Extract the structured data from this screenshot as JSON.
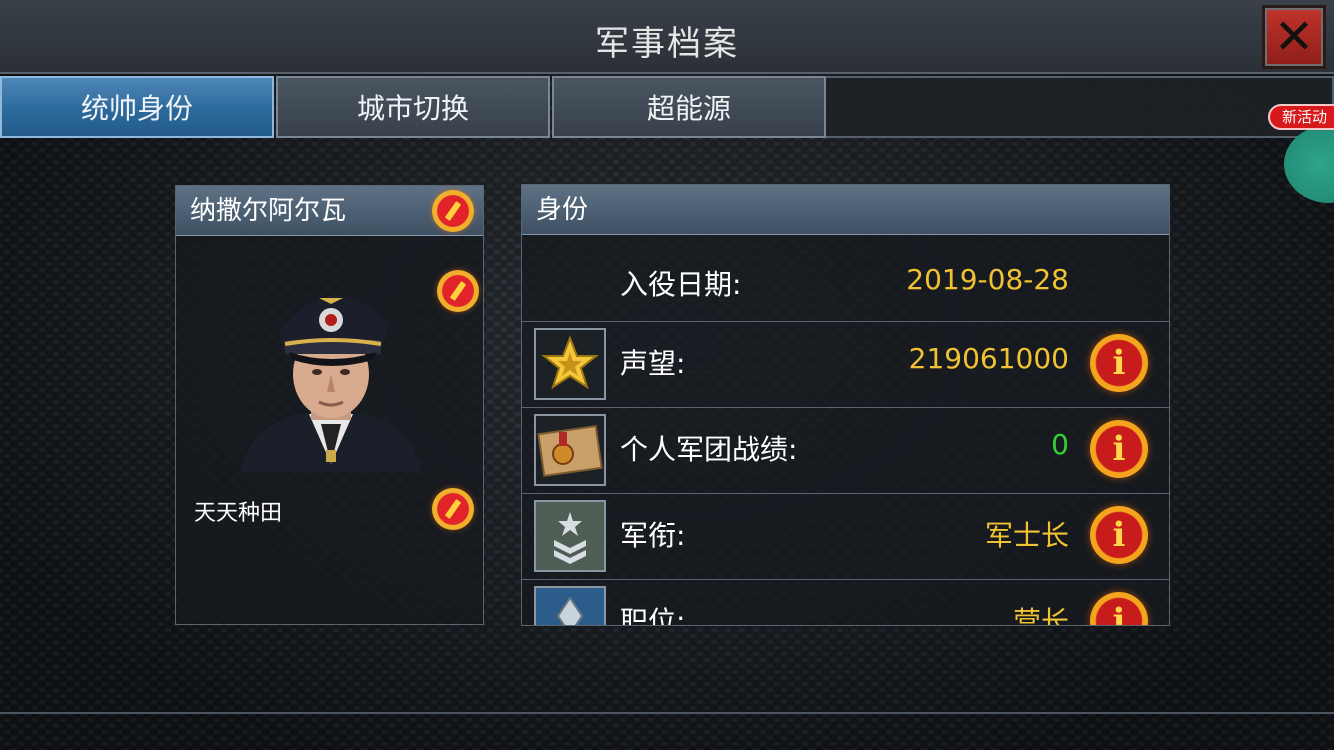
{
  "header": {
    "title": "军事档案"
  },
  "tabs": [
    {
      "label": "统帅身份",
      "active": true
    },
    {
      "label": "城市切换",
      "active": false
    },
    {
      "label": "超能源",
      "active": false
    }
  ],
  "side_badge": {
    "label": "新活动"
  },
  "commander": {
    "title": "纳撒尔阿尔瓦",
    "name": "天天种田"
  },
  "identity": {
    "header": "身份",
    "rows": [
      {
        "label": "入役日期:",
        "value": "2019-08-28",
        "value_color": "#f1c232",
        "icon": ""
      },
      {
        "label": "声望:",
        "value": "219061000",
        "value_color": "#f1c232",
        "icon": "gold-star-icon"
      },
      {
        "label": "个人军团战绩:",
        "value": "0",
        "value_color": "#35d035",
        "icon": "medal-certificate-icon"
      },
      {
        "label": "军衔:",
        "value": "军士长",
        "value_color": "#f1c232",
        "icon": "rank-chevron-icon"
      },
      {
        "label": "职位:",
        "value": "营长",
        "value_color": "#f1c232",
        "icon": "position-badge-icon"
      }
    ]
  },
  "colors": {
    "accent_gold": "#f1c232",
    "accent_green": "#35d035",
    "tab_active": "#2d6a9c",
    "close_red": "#b02a22"
  }
}
